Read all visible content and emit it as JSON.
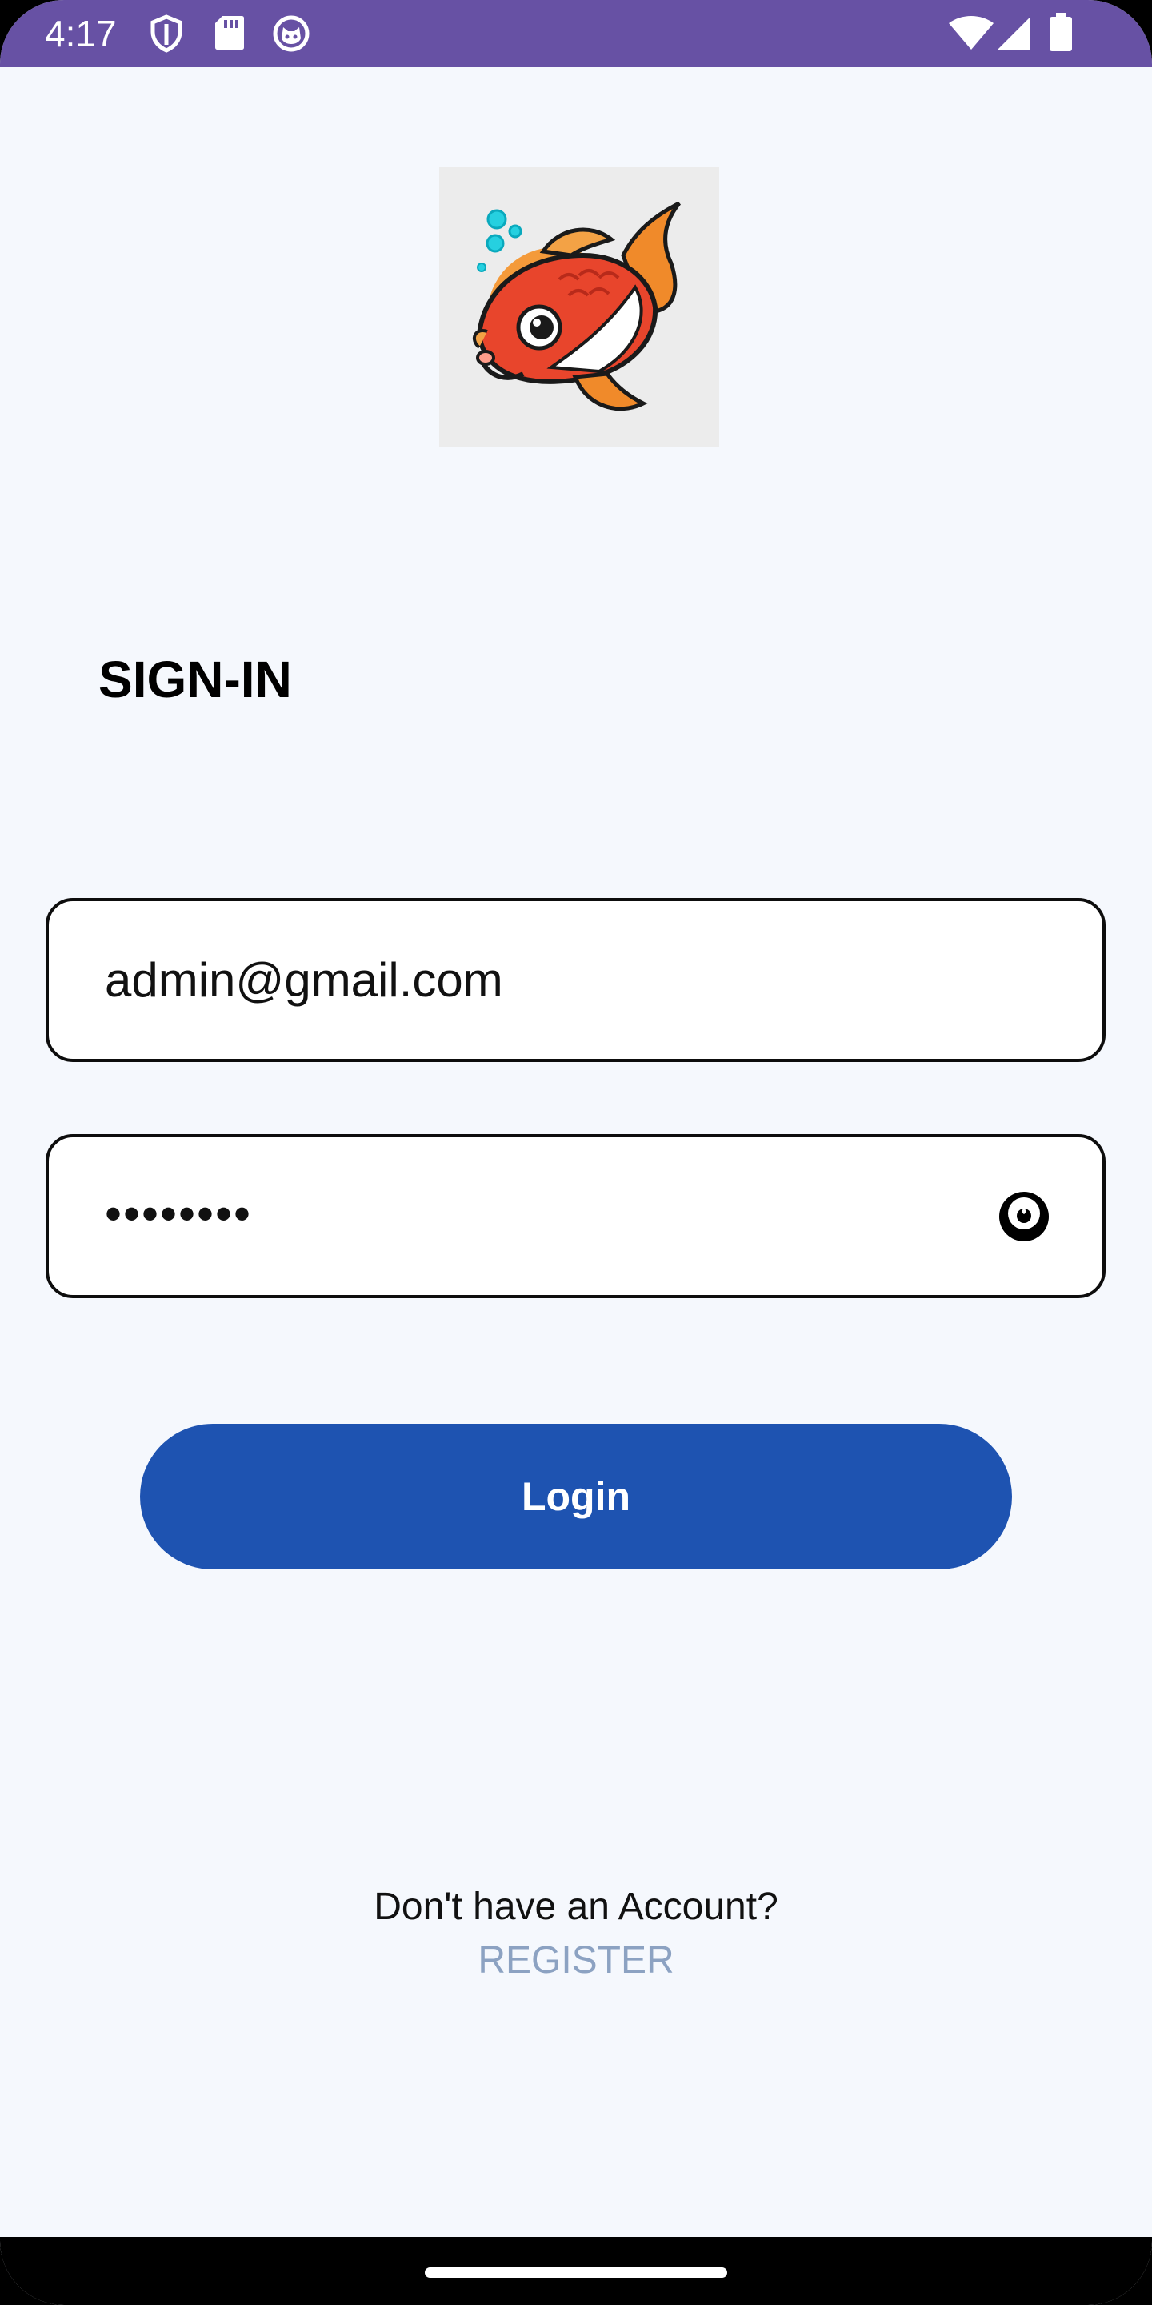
{
  "status_bar": {
    "time": "4:17",
    "icons_left": [
      "shield-icon",
      "sd-card-icon",
      "cat-face-icon"
    ],
    "icons_right": [
      "wifi-icon",
      "cellular-signal-icon",
      "battery-icon"
    ],
    "background": "#6751a4"
  },
  "logo": {
    "icon": "koi-fish-logo"
  },
  "heading": "SIGN-IN",
  "email_field": {
    "value": "admin@gmail.com"
  },
  "password_field": {
    "value": "••••••••",
    "toggle_icon": "eye-icon"
  },
  "login_button": {
    "label": "Login",
    "color": "#1e53b1"
  },
  "footer": {
    "prompt": "Don't have an Account?",
    "register_label": "REGISTER",
    "register_color": "#8ca2c2"
  }
}
